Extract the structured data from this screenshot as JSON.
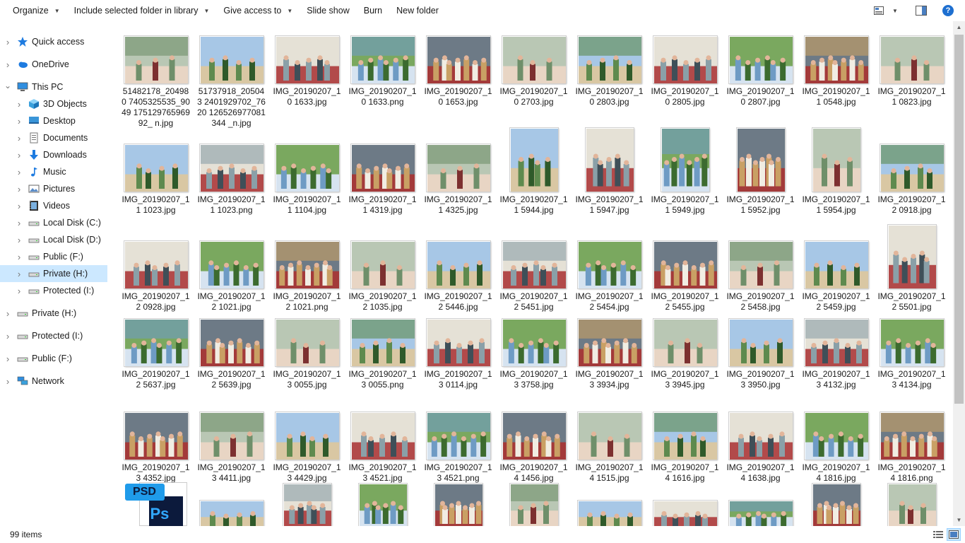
{
  "toolbar": {
    "organize": "Organize",
    "include_library": "Include selected folder in library",
    "give_access": "Give access to",
    "slide_show": "Slide show",
    "burn": "Burn",
    "new_folder": "New folder",
    "help": "?"
  },
  "nav": {
    "items": [
      {
        "label": "Quick access",
        "icon": "star-icon",
        "level": 0
      },
      {
        "label": "OneDrive",
        "icon": "cloud-icon",
        "level": 0
      },
      {
        "label": "This PC",
        "icon": "computer-icon",
        "level": 0,
        "expanded": true
      },
      {
        "label": "3D Objects",
        "icon": "cube-icon",
        "level": 1
      },
      {
        "label": "Desktop",
        "icon": "desktop-icon",
        "level": 1
      },
      {
        "label": "Documents",
        "icon": "document-icon",
        "level": 1
      },
      {
        "label": "Downloads",
        "icon": "download-icon",
        "level": 1
      },
      {
        "label": "Music",
        "icon": "music-icon",
        "level": 1
      },
      {
        "label": "Pictures",
        "icon": "pictures-icon",
        "level": 1
      },
      {
        "label": "Videos",
        "icon": "video-icon",
        "level": 1
      },
      {
        "label": "Local Disk (C:)",
        "icon": "drive-icon",
        "level": 1
      },
      {
        "label": "Local Disk (D:)",
        "icon": "drive-icon",
        "level": 1
      },
      {
        "label": "Public (F:)",
        "icon": "drive-icon",
        "level": 1
      },
      {
        "label": "Private (H:)",
        "icon": "drive-icon",
        "level": 1,
        "selected": true
      },
      {
        "label": "Protected (I:)",
        "icon": "drive-icon",
        "level": 1
      },
      {
        "label": "Private (H:)",
        "icon": "drive-icon",
        "level": 0
      },
      {
        "label": "Protected (I:)",
        "icon": "drive-icon",
        "level": 0
      },
      {
        "label": "Public (F:)",
        "icon": "drive-icon",
        "level": 0
      },
      {
        "label": "Network",
        "icon": "network-icon",
        "level": 0
      }
    ]
  },
  "files": [
    [
      "51482178_204980 7405325535_9049 17512976596992_ n.jpg",
      "51737918_205043 2401929702_7620 126526977081344 _n.jpg",
      "IMG_20190207_10 1633.jpg",
      "IMG_20190207_10 1633.png",
      "IMG_20190207_10 1653.jpg",
      "IMG_20190207_10 2703.jpg",
      "IMG_20190207_10 2803.jpg",
      "IMG_20190207_10 2805.jpg",
      "IMG_20190207_10 2807.jpg",
      "IMG_20190207_11 0548.jpg",
      "IMG_20190207_11 0823.jpg"
    ],
    [
      "IMG_20190207_11 1023.jpg",
      "IMG_20190207_11 1023.png",
      "IMG_20190207_11 1104.jpg",
      "IMG_20190207_11 4319.jpg",
      "IMG_20190207_11 4325.jpg",
      "IMG_20190207_11 5944.jpg",
      "IMG_20190207_11 5947.jpg",
      "IMG_20190207_11 5949.jpg",
      "IMG_20190207_11 5952.jpg",
      "IMG_20190207_11 5954.jpg",
      "IMG_20190207_12 0918.jpg"
    ],
    [
      "IMG_20190207_12 0928.jpg",
      "IMG_20190207_12 1021.jpg",
      "IMG_20190207_12 1021.png",
      "IMG_20190207_12 1035.jpg",
      "IMG_20190207_12 5446.jpg",
      "IMG_20190207_12 5451.jpg",
      "IMG_20190207_12 5454.jpg",
      "IMG_20190207_12 5455.jpg",
      "IMG_20190207_12 5458.jpg",
      "IMG_20190207_12 5459.jpg",
      "IMG_20190207_12 5501.jpg"
    ],
    [
      "IMG_20190207_12 5637.jpg",
      "IMG_20190207_12 5639.jpg",
      "IMG_20190207_13 0055.jpg",
      "IMG_20190207_13 0055.png",
      "IMG_20190207_13 0114.jpg",
      "IMG_20190207_13 3758.jpg",
      "IMG_20190207_13 3934.jpg",
      "IMG_20190207_13 3945.jpg",
      "IMG_20190207_13 3950.jpg",
      "IMG_20190207_13 4132.jpg",
      "IMG_20190207_13 4134.jpg"
    ],
    [
      "IMG_20190207_13 4352.jpg",
      "IMG_20190207_13 4411.jpg",
      "IMG_20190207_13 4429.jpg",
      "IMG_20190207_13 4521.jpg",
      "IMG_20190207_13 4521.png",
      "IMG_20190207_14 1456.jpg",
      "IMG_20190207_14 1515.jpg",
      "IMG_20190207_14 1616.jpg",
      "IMG_20190207_14 1638.jpg",
      "IMG_20190207_14 1816.jpg",
      "IMG_20190207_14 1816.png"
    ],
    [
      "",
      "",
      "",
      "",
      "",
      "",
      "",
      "",
      "",
      "",
      ""
    ]
  ],
  "psd_badge": "PSD",
  "psd_logo": "Ps",
  "status": {
    "item_count": "99 items"
  }
}
